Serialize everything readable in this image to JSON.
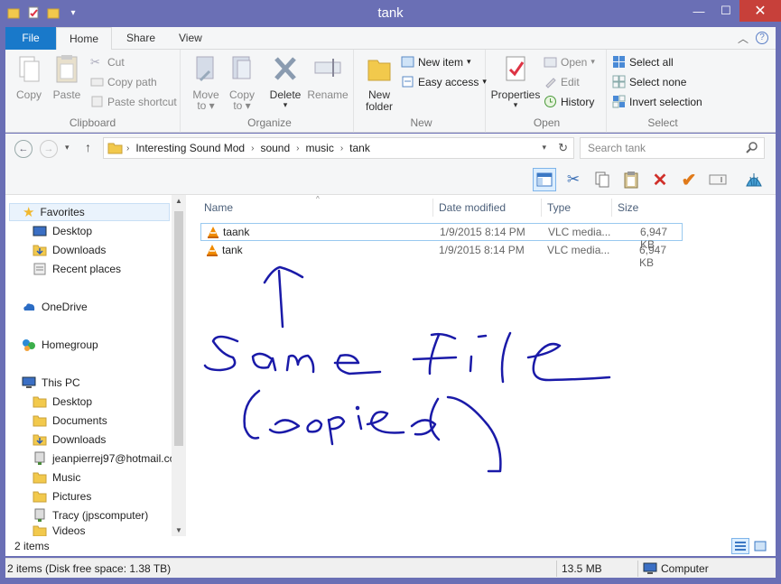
{
  "window": {
    "title": "tank"
  },
  "quick_access": [
    "folder-icon",
    "properties-icon",
    "new-folder-icon",
    "customize-qat-icon"
  ],
  "window_controls": {
    "minimize": "—",
    "maximize": "☐",
    "close": "✕"
  },
  "tabs": {
    "file": "File",
    "home": "Home",
    "share": "Share",
    "view": "View"
  },
  "ribbon": {
    "clipboard": {
      "label": "Clipboard",
      "copy": "Copy",
      "paste": "Paste",
      "cut": "Cut",
      "copy_path": "Copy path",
      "paste_shortcut": "Paste shortcut"
    },
    "organize": {
      "label": "Organize",
      "move_to": "Move",
      "move_to2": "to",
      "copy_to": "Copy",
      "copy_to2": "to",
      "delete": "Delete",
      "rename": "Rename"
    },
    "new": {
      "label": "New",
      "new_folder": "New",
      "new_folder2": "folder",
      "new_item": "New item",
      "easy_access": "Easy access"
    },
    "open": {
      "label": "Open",
      "properties": "Properties",
      "open": "Open",
      "edit": "Edit",
      "history": "History"
    },
    "select": {
      "label": "Select",
      "select_all": "Select all",
      "select_none": "Select none",
      "invert_selection": "Invert selection"
    }
  },
  "address": {
    "crumbs": [
      "Interesting Sound Mod",
      "sound",
      "music",
      "tank"
    ],
    "search_placeholder": "Search tank"
  },
  "nav": {
    "favorites": "Favorites",
    "desktop": "Desktop",
    "downloads": "Downloads",
    "recent_places": "Recent places",
    "onedrive": "OneDrive",
    "homegroup": "Homegroup",
    "this_pc": "This PC",
    "pc_desktop": "Desktop",
    "pc_documents": "Documents",
    "pc_downloads": "Downloads",
    "pc_email": "jeanpierrej97@hotmail.co",
    "pc_music": "Music",
    "pc_pictures": "Pictures",
    "pc_tracy": "Tracy (jpscomputer)",
    "pc_videos": "Videos"
  },
  "columns": {
    "name": "Name",
    "date": "Date modified",
    "type": "Type",
    "size": "Size"
  },
  "files": [
    {
      "name": "taank",
      "date": "1/9/2015 8:14 PM",
      "type": "VLC media...",
      "size": "6,947 KB"
    },
    {
      "name": "tank",
      "date": "1/9/2015 8:14 PM",
      "type": "VLC media...",
      "size": "6,947 KB"
    }
  ],
  "status": {
    "item_count": "2 items",
    "detail": "2 items (Disk free space: 1.38 TB)",
    "size": "13.5 MB",
    "location": "Computer"
  },
  "annotation_color": "#1a1aa8",
  "vlc_color": "#f08a00"
}
